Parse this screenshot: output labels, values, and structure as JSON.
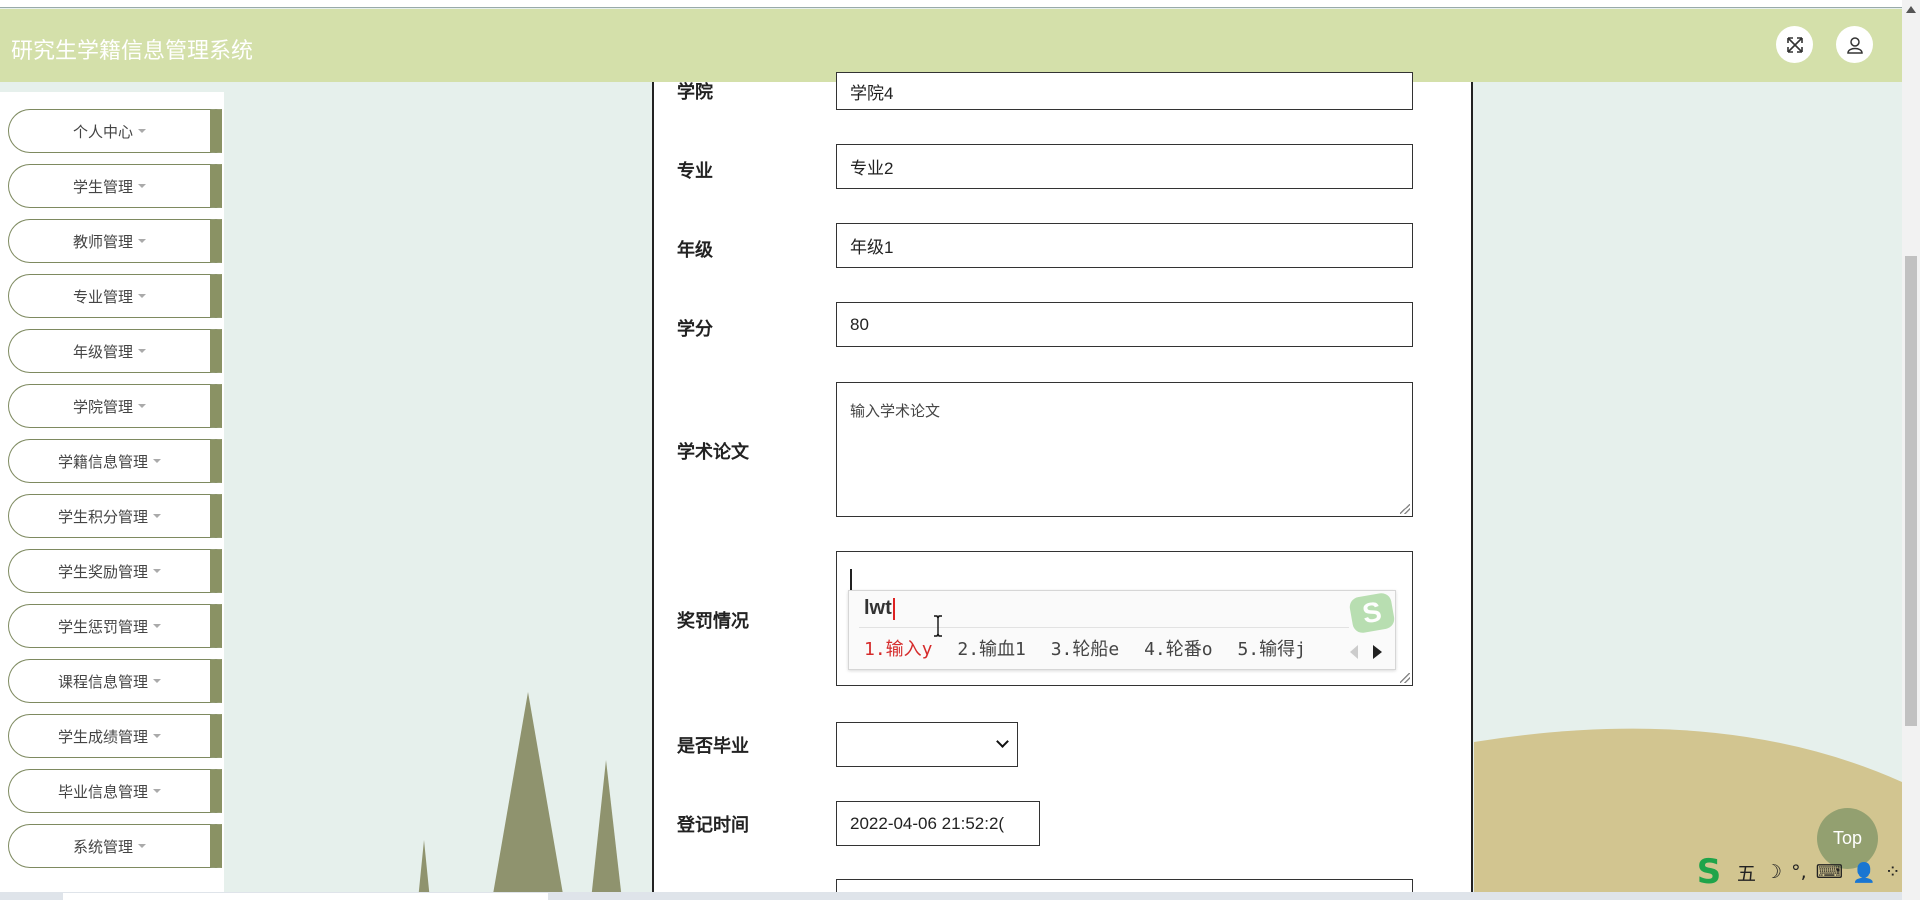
{
  "header": {
    "title": "研究生学籍信息管理系统",
    "fullscreen_icon": "expand-arrows-icon",
    "user_icon": "user-icon"
  },
  "sidebar": {
    "items": [
      {
        "label": "个人中心"
      },
      {
        "label": "学生管理"
      },
      {
        "label": "教师管理"
      },
      {
        "label": "专业管理"
      },
      {
        "label": "年级管理"
      },
      {
        "label": "学院管理"
      },
      {
        "label": "学籍信息管理"
      },
      {
        "label": "学生积分管理"
      },
      {
        "label": "学生奖励管理"
      },
      {
        "label": "学生惩罚管理"
      },
      {
        "label": "课程信息管理"
      },
      {
        "label": "学生成绩管理"
      },
      {
        "label": "毕业信息管理"
      },
      {
        "label": "系统管理"
      }
    ]
  },
  "form": {
    "college": {
      "label": "学院",
      "value": "学院4"
    },
    "major": {
      "label": "专业",
      "value": "专业2"
    },
    "grade": {
      "label": "年级",
      "value": "年级1"
    },
    "credits": {
      "label": "学分",
      "value": "80"
    },
    "paper": {
      "label": "学术论文",
      "placeholder": "输入学术论文"
    },
    "rewards": {
      "label": "奖罚情况",
      "value": ""
    },
    "graduated": {
      "label": "是否毕业",
      "value": ""
    },
    "register_time": {
      "label": "登记时间",
      "value": "2022-04-06 21:52:2("
    }
  },
  "ime": {
    "composition": "lwt",
    "candidates": [
      "1.输入y",
      "2.输血1",
      "3.轮船e",
      "4.轮番o",
      "5.输得j"
    ],
    "logo": "S"
  },
  "top_button": {
    "label": "Top"
  },
  "ime_toolbar": {
    "logo": "S",
    "items": [
      "五",
      "☽",
      "°,",
      "⌨",
      "👤",
      "⁘"
    ]
  }
}
